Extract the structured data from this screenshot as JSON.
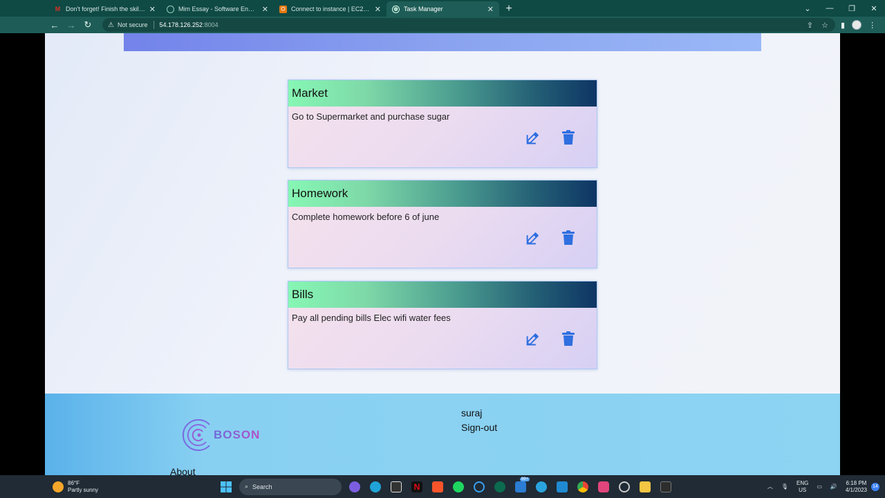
{
  "browser": {
    "tabs": [
      {
        "title": "Don't forget! Finish the skills qu",
        "icon": "gmail-icon",
        "color": "#d93025"
      },
      {
        "title": "Mim Essay - Software Engineer -",
        "icon": "circle-icon",
        "color": "#444"
      },
      {
        "title": "Connect to instance | EC2 Manag",
        "icon": "aws-icon",
        "color": "#e47911"
      },
      {
        "title": "Task Manager",
        "icon": "globe-icon",
        "color": "#cfe"
      }
    ],
    "security_label": "Not secure",
    "url_host": "54.178.126.252",
    "url_port": ":8004"
  },
  "tasks": [
    {
      "title": "Market",
      "description": "Go to Supermarket and purchase sugar"
    },
    {
      "title": "Homework",
      "description": "Complete homework before 6 of june"
    },
    {
      "title": "Bills",
      "description": "Pay all pending bills Elec wifi water fees"
    }
  ],
  "footer": {
    "logo_text": "BOSON",
    "username": "suraj",
    "signout": "Sign-out",
    "about": "About"
  },
  "taskbar": {
    "temperature": "86°F",
    "weather": "Partly sunny",
    "search": "Search",
    "lang": "ENG",
    "region": "US",
    "time": "6:18 PM",
    "date": "4/1/2023",
    "badge": "99+",
    "notifications": "14"
  },
  "colors": {
    "icon_blue": "#2f6fe0",
    "footer_bg": "#8dd3f2"
  }
}
